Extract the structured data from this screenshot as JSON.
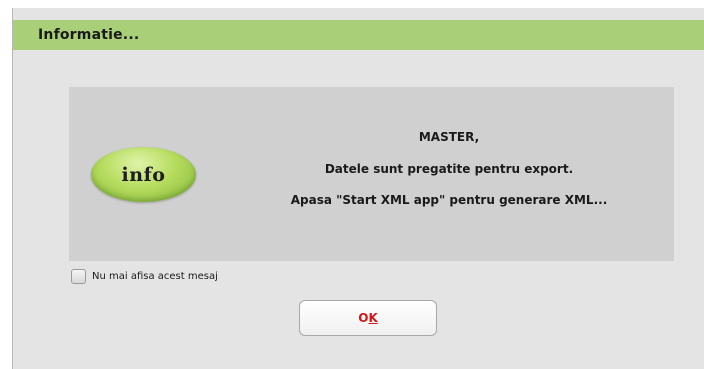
{
  "dialog": {
    "title": "Informatie...",
    "icon_label": "info",
    "message": {
      "line1": "MASTER,",
      "line2": "Datele sunt pregatite pentru export.",
      "line3": "Apasa \"Start XML app\" pentru generare XML..."
    },
    "checkbox": {
      "label": "Nu mai afisa acest mesaj",
      "checked": false
    },
    "ok_button": {
      "label_first": "O",
      "label_mnemonic": "K"
    }
  },
  "colors": {
    "title_bar": "#a9cf79",
    "ok_text": "#d01818",
    "panel": "#d0d0d0",
    "window": "#e4e4e4"
  }
}
